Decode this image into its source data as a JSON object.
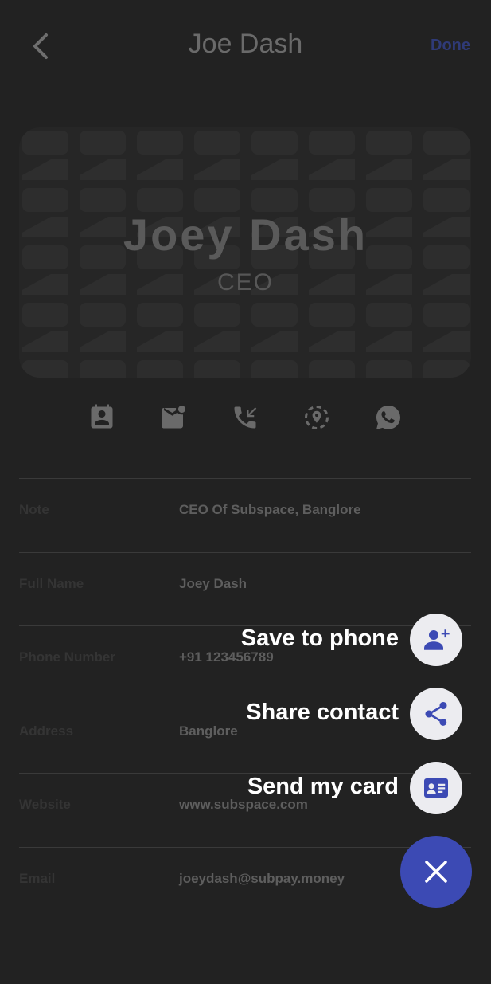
{
  "header": {
    "title": "Joe Dash",
    "done_label": "Done"
  },
  "card": {
    "name": "Joey Dash",
    "role": "CEO"
  },
  "actions": [
    {
      "icon": "contact-card-icon"
    },
    {
      "icon": "mail-notification-icon"
    },
    {
      "icon": "phone-callback-icon"
    },
    {
      "icon": "location-icon"
    },
    {
      "icon": "whatsapp-icon"
    }
  ],
  "details": [
    {
      "label": "Note",
      "value": "CEO Of Subspace, Banglore"
    },
    {
      "label": "Full Name",
      "value": "Joey Dash"
    },
    {
      "label": "Phone Number",
      "value": "+91 123456789"
    },
    {
      "label": "Address",
      "value": "Banglore"
    },
    {
      "label": "Website",
      "value": "www.subspace.com"
    },
    {
      "label": "Email",
      "value": "joeydash@subpay.money"
    }
  ],
  "speed_dial": {
    "items": [
      {
        "label": "Save to phone",
        "icon": "add-person-icon"
      },
      {
        "label": "Share contact",
        "icon": "share-icon"
      },
      {
        "label": "Send my card",
        "icon": "id-card-icon"
      }
    ],
    "close_icon": "close-icon"
  },
  "colors": {
    "background": "#222222",
    "accent": "#3c4ab4",
    "dial_button": "#ececf0"
  }
}
